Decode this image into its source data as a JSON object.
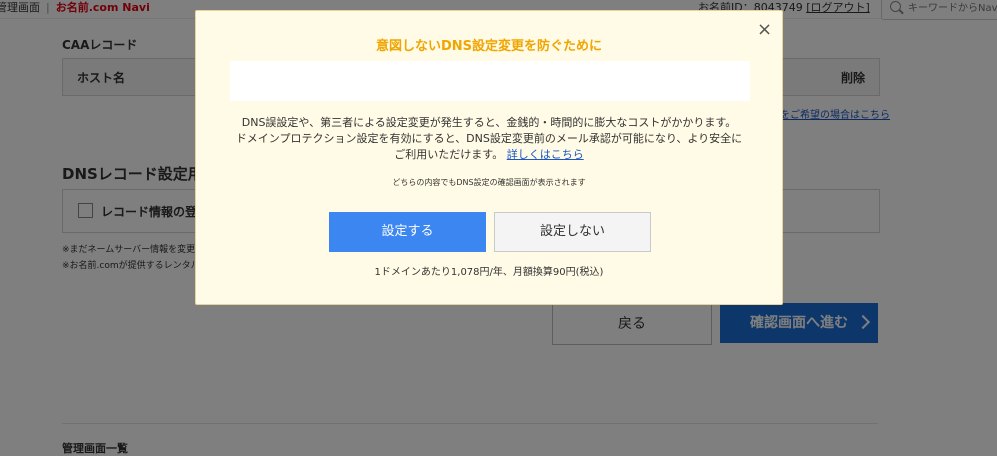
{
  "topbar": {
    "admin_label": "管理画面",
    "separator": "|",
    "brand": "お名前.com Navi",
    "account_label": "お名前ID：8043749",
    "logout": "[ログアウト]",
    "search_placeholder": "キーワードからNavi内"
  },
  "caa": {
    "heading": "CAAレコード",
    "col_host": "ホスト名",
    "col_delete": "削除",
    "hint_link": "をご希望の場合はこちら"
  },
  "dns": {
    "heading": "DNSレコード設定用ネ",
    "checkbox_label": "レコード情報の登録",
    "note1": "※まだネームサーバー情報を変更さ",
    "note2": "※お名前.comが提供するレンタル"
  },
  "actions": {
    "back": "戻る",
    "next": "確認画面へ進む"
  },
  "footer": {
    "admin_list": "管理画面一覧"
  },
  "modal": {
    "close": "×",
    "title": "意図しないDNS設定変更を防ぐために",
    "body_line1": "DNS誤設定や、第三者による設定変更が発生すると、金銭的・時間的に膨大なコストがかかります。",
    "body_line2": "ドメインプロテクション設定を有効にすると、DNS設定変更前のメール承認が可能になり、より安全に",
    "body_line3": "ご利用いただけます。",
    "details_link": "詳しくはこちら",
    "small_note": "どちらの内容でもDNS設定の確認画面が表示されます",
    "btn_set": "設定する",
    "btn_no": "設定しない",
    "price": "1ドメインあたり1,078円/年、月額換算90円(税込)"
  },
  "colors": {
    "title_accent": "#f0a500",
    "primary_button": "#3b86f0",
    "next_button": "#1b6fd6",
    "modal_bg": "#fffbe6",
    "brand": "#e60012"
  }
}
